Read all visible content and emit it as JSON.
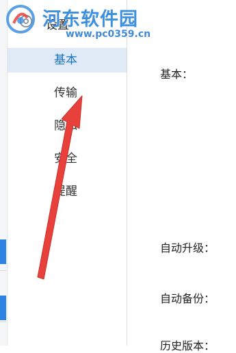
{
  "window": {
    "title": "设置"
  },
  "sidebar": {
    "items": [
      {
        "label": "基本",
        "active": true
      },
      {
        "label": "传输",
        "active": false
      },
      {
        "label": "隐私",
        "active": false
      },
      {
        "label": "安全",
        "active": false
      },
      {
        "label": "提醒",
        "active": false
      }
    ]
  },
  "content": {
    "sections": [
      {
        "label": "基本："
      },
      {
        "label": "自动升级："
      },
      {
        "label": "自动备份："
      },
      {
        "label": "历史版本："
      }
    ]
  },
  "watermark": {
    "title": "河东软件园",
    "url": "www.pc0359.cn"
  },
  "colors": {
    "accent": "#1a73c8",
    "active_bg": "#dfeaf6",
    "arrow": "#e8403b",
    "watermark": "#3d8fe0"
  },
  "icons": {
    "title_icon": "gear-icon",
    "annotation": "red-arrow-icon"
  }
}
